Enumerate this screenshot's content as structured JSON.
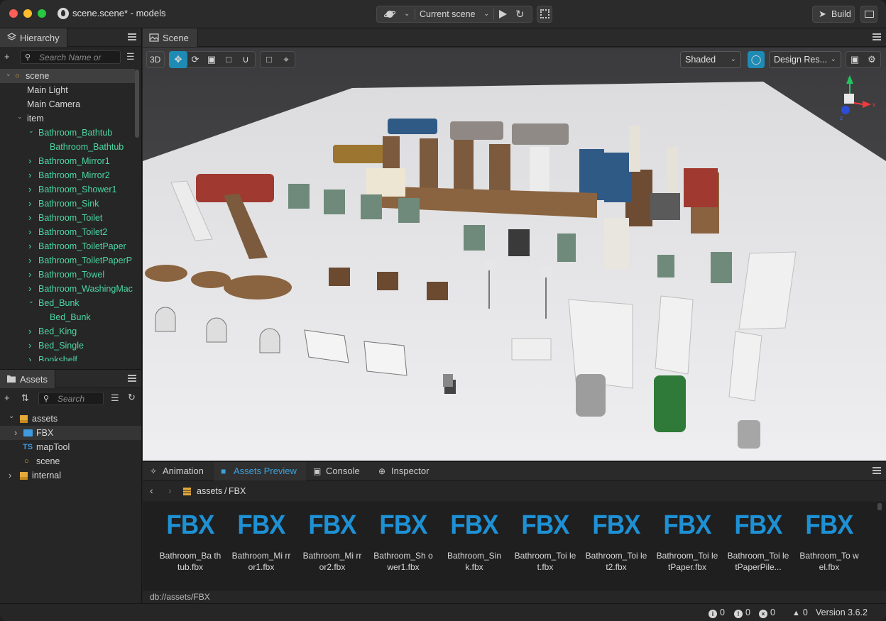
{
  "window": {
    "title": "scene.scene* - models"
  },
  "toolbar": {
    "current_scene": "Current scene",
    "build_label": "Build"
  },
  "hierarchy": {
    "tab": "Hierarchy",
    "search_placeholder": "Search Name or",
    "items": [
      {
        "label": "scene",
        "depth": 0,
        "expanded": true,
        "selected": true,
        "green": false,
        "icon": "scene-icon"
      },
      {
        "label": "Main Light",
        "depth": 1,
        "green": false
      },
      {
        "label": "Main Camera",
        "depth": 1,
        "green": false
      },
      {
        "label": "item",
        "depth": 1,
        "expanded": true,
        "green": false
      },
      {
        "label": "Bathroom_Bathtub",
        "depth": 2,
        "expanded": true,
        "green": true
      },
      {
        "label": "Bathroom_Bathtub",
        "depth": 3,
        "green": true
      },
      {
        "label": "Bathroom_Mirror1",
        "depth": 2,
        "expanded": false,
        "green": true
      },
      {
        "label": "Bathroom_Mirror2",
        "depth": 2,
        "expanded": false,
        "green": true
      },
      {
        "label": "Bathroom_Shower1",
        "depth": 2,
        "expanded": false,
        "green": true
      },
      {
        "label": "Bathroom_Sink",
        "depth": 2,
        "expanded": false,
        "green": true
      },
      {
        "label": "Bathroom_Toilet",
        "depth": 2,
        "expanded": false,
        "green": true
      },
      {
        "label": "Bathroom_Toilet2",
        "depth": 2,
        "expanded": false,
        "green": true
      },
      {
        "label": "Bathroom_ToiletPaper",
        "depth": 2,
        "expanded": false,
        "green": true
      },
      {
        "label": "Bathroom_ToiletPaperP",
        "depth": 2,
        "expanded": false,
        "green": true
      },
      {
        "label": "Bathroom_Towel",
        "depth": 2,
        "expanded": false,
        "green": true
      },
      {
        "label": "Bathroom_WashingMac",
        "depth": 2,
        "expanded": false,
        "green": true
      },
      {
        "label": "Bed_Bunk",
        "depth": 2,
        "expanded": true,
        "green": true
      },
      {
        "label": "Bed_Bunk",
        "depth": 3,
        "green": true
      },
      {
        "label": "Bed_King",
        "depth": 2,
        "expanded": false,
        "green": true
      },
      {
        "label": "Bed_Single",
        "depth": 2,
        "expanded": false,
        "green": true
      },
      {
        "label": "Bookshelf",
        "depth": 2,
        "expanded": false,
        "green": true
      }
    ]
  },
  "assets": {
    "tab": "Assets",
    "search_placeholder": "Search",
    "items": [
      {
        "label": "assets",
        "depth": 0,
        "expanded": true,
        "icon": "db-icon"
      },
      {
        "label": "FBX",
        "depth": 1,
        "expanded": false,
        "icon": "folder-icon",
        "highlight": true
      },
      {
        "label": "mapTool",
        "depth": 1,
        "icon": "ts-icon",
        "badge": "TS"
      },
      {
        "label": "scene",
        "depth": 1,
        "icon": "scene-icon"
      },
      {
        "label": "internal",
        "depth": 0,
        "expanded": false,
        "icon": "db-icon"
      }
    ]
  },
  "scene": {
    "tab": "Scene",
    "mode_3d": "3D",
    "shading": "Shaded",
    "resolution": "Design Res...",
    "gizmo_axes": {
      "x": "x",
      "y": "y",
      "z": "z"
    }
  },
  "bottom": {
    "tabs": [
      {
        "label": "Animation",
        "icon": "animation-icon",
        "active": false
      },
      {
        "label": "Assets Preview",
        "icon": "folder-icon",
        "active": true
      },
      {
        "label": "Console",
        "icon": "console-icon",
        "active": false
      },
      {
        "label": "Inspector",
        "icon": "inspector-icon",
        "active": false
      }
    ],
    "breadcrumb_root": "assets",
    "breadcrumb_sep": "/",
    "breadcrumb_leaf": "FBX",
    "fbx_label": "FBX",
    "files": [
      {
        "name": "Bathroom_Ba thtub.fbx"
      },
      {
        "name": "Bathroom_Mi rror1.fbx"
      },
      {
        "name": "Bathroom_Mi rror2.fbx"
      },
      {
        "name": "Bathroom_Sh ower1.fbx"
      },
      {
        "name": "Bathroom_Sin k.fbx"
      },
      {
        "name": "Bathroom_Toi let.fbx"
      },
      {
        "name": "Bathroom_Toi let2.fbx"
      },
      {
        "name": "Bathroom_Toi letPaper.fbx"
      },
      {
        "name": "Bathroom_Toi letPaperPile..."
      },
      {
        "name": "Bathroom_To wel.fbx"
      }
    ],
    "path": "db://assets/FBX"
  },
  "status": {
    "info_count": "0",
    "warn_count": "0",
    "error_count": "0",
    "notify_count": "0",
    "version": "Version 3.6.2"
  },
  "colors": {
    "accent": "#1e90d4",
    "green_node": "#4dd6a4",
    "active_tab": "#3ea2dd"
  }
}
